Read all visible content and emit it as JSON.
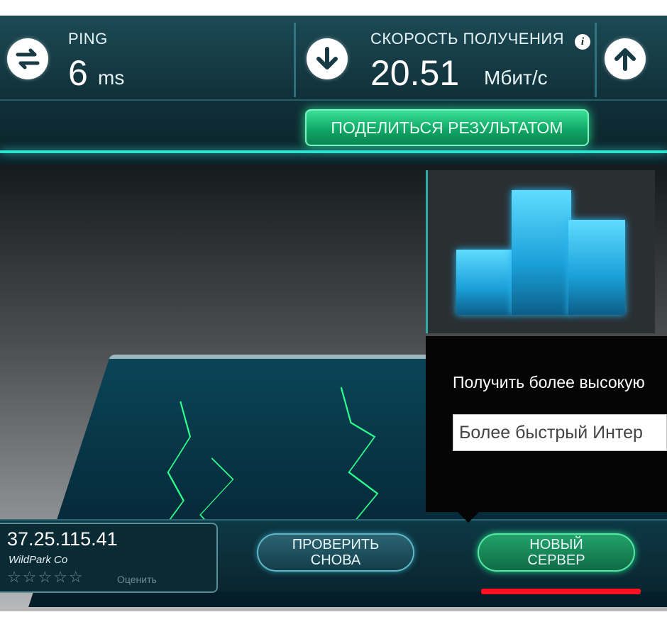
{
  "header": {
    "ping_label": "PING",
    "ping_value": "6",
    "ping_unit": "ms",
    "download_label": "СКОРОСТЬ ПОЛУЧЕНИЯ",
    "download_value": "20.51",
    "download_unit": "Мбит/с",
    "info_icon": "i",
    "share_button": "ПОДЕЛИТЬСЯ РЕЗУЛЬТАТОМ"
  },
  "icons": {
    "ping": "ping-arrows-icon",
    "download": "download-arrow-icon",
    "upload": "upload-arrow-icon",
    "info": "info-icon"
  },
  "popup": {
    "title": "Получить более высокую",
    "input_value": "Более быстрый Интер"
  },
  "server": {
    "ip": "37.25.115.41",
    "isp": "WildPark Co",
    "stars": "☆☆☆☆☆",
    "rate_label": "Оценить"
  },
  "buttons": {
    "retest_line1": "ПРОВЕРИТЬ",
    "retest_line2": "СНОВА",
    "new_server_line1": "НОВЫЙ",
    "new_server_line2": "СЕРВЕР"
  },
  "colors": {
    "accent_green": "#10a866",
    "accent_cyan": "#2de0d0",
    "highlight_red": "#ff1020"
  }
}
